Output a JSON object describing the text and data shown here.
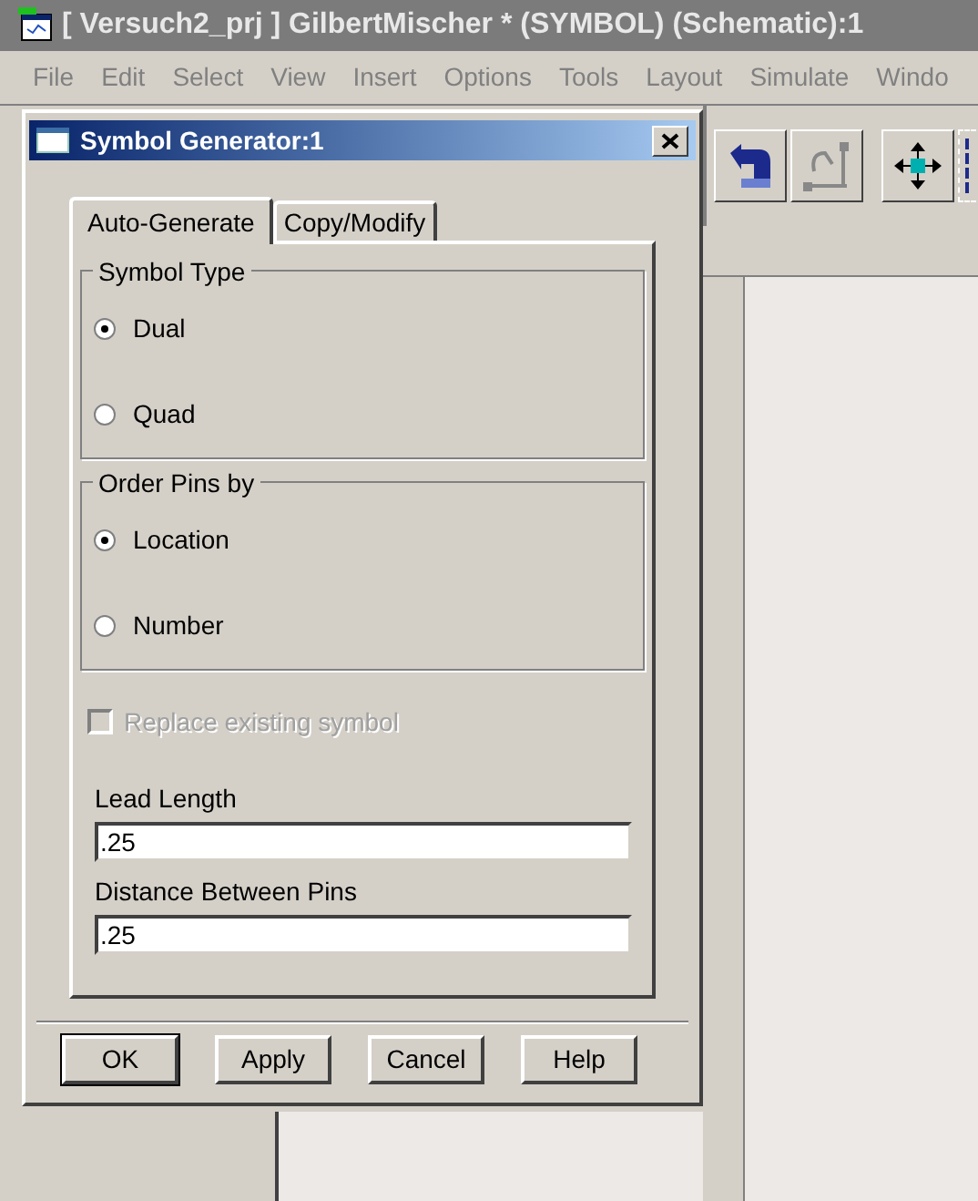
{
  "window": {
    "title": "[ Versuch2_prj ] GilbertMischer * (SYMBOL) (Schematic):1"
  },
  "menu": [
    "File",
    "Edit",
    "Select",
    "View",
    "Insert",
    "Options",
    "Tools",
    "Layout",
    "Simulate",
    "Windo"
  ],
  "dialog": {
    "title": "Symbol Generator:1",
    "tabs": [
      {
        "label": "Auto-Generate",
        "selected": true
      },
      {
        "label": "Copy/Modify",
        "selected": false
      }
    ],
    "groups": [
      {
        "title": "Symbol Type",
        "options": [
          {
            "label": "Dual",
            "selected": true
          },
          {
            "label": "Quad",
            "selected": false
          }
        ]
      },
      {
        "title": "Order Pins by",
        "options": [
          {
            "label": "Location",
            "selected": true
          },
          {
            "label": "Number",
            "selected": false
          }
        ]
      }
    ],
    "replace_existing": {
      "label": "Replace existing symbol",
      "checked": false,
      "disabled": true
    },
    "fields": [
      {
        "label": "Lead Length",
        "value": ".25"
      },
      {
        "label": "Distance Between Pins",
        "value": ".25"
      }
    ],
    "buttons": [
      {
        "label": "OK",
        "default": true
      },
      {
        "label": "Apply",
        "default": false
      },
      {
        "label": "Cancel",
        "default": false
      },
      {
        "label": "Help",
        "default": false
      }
    ]
  }
}
